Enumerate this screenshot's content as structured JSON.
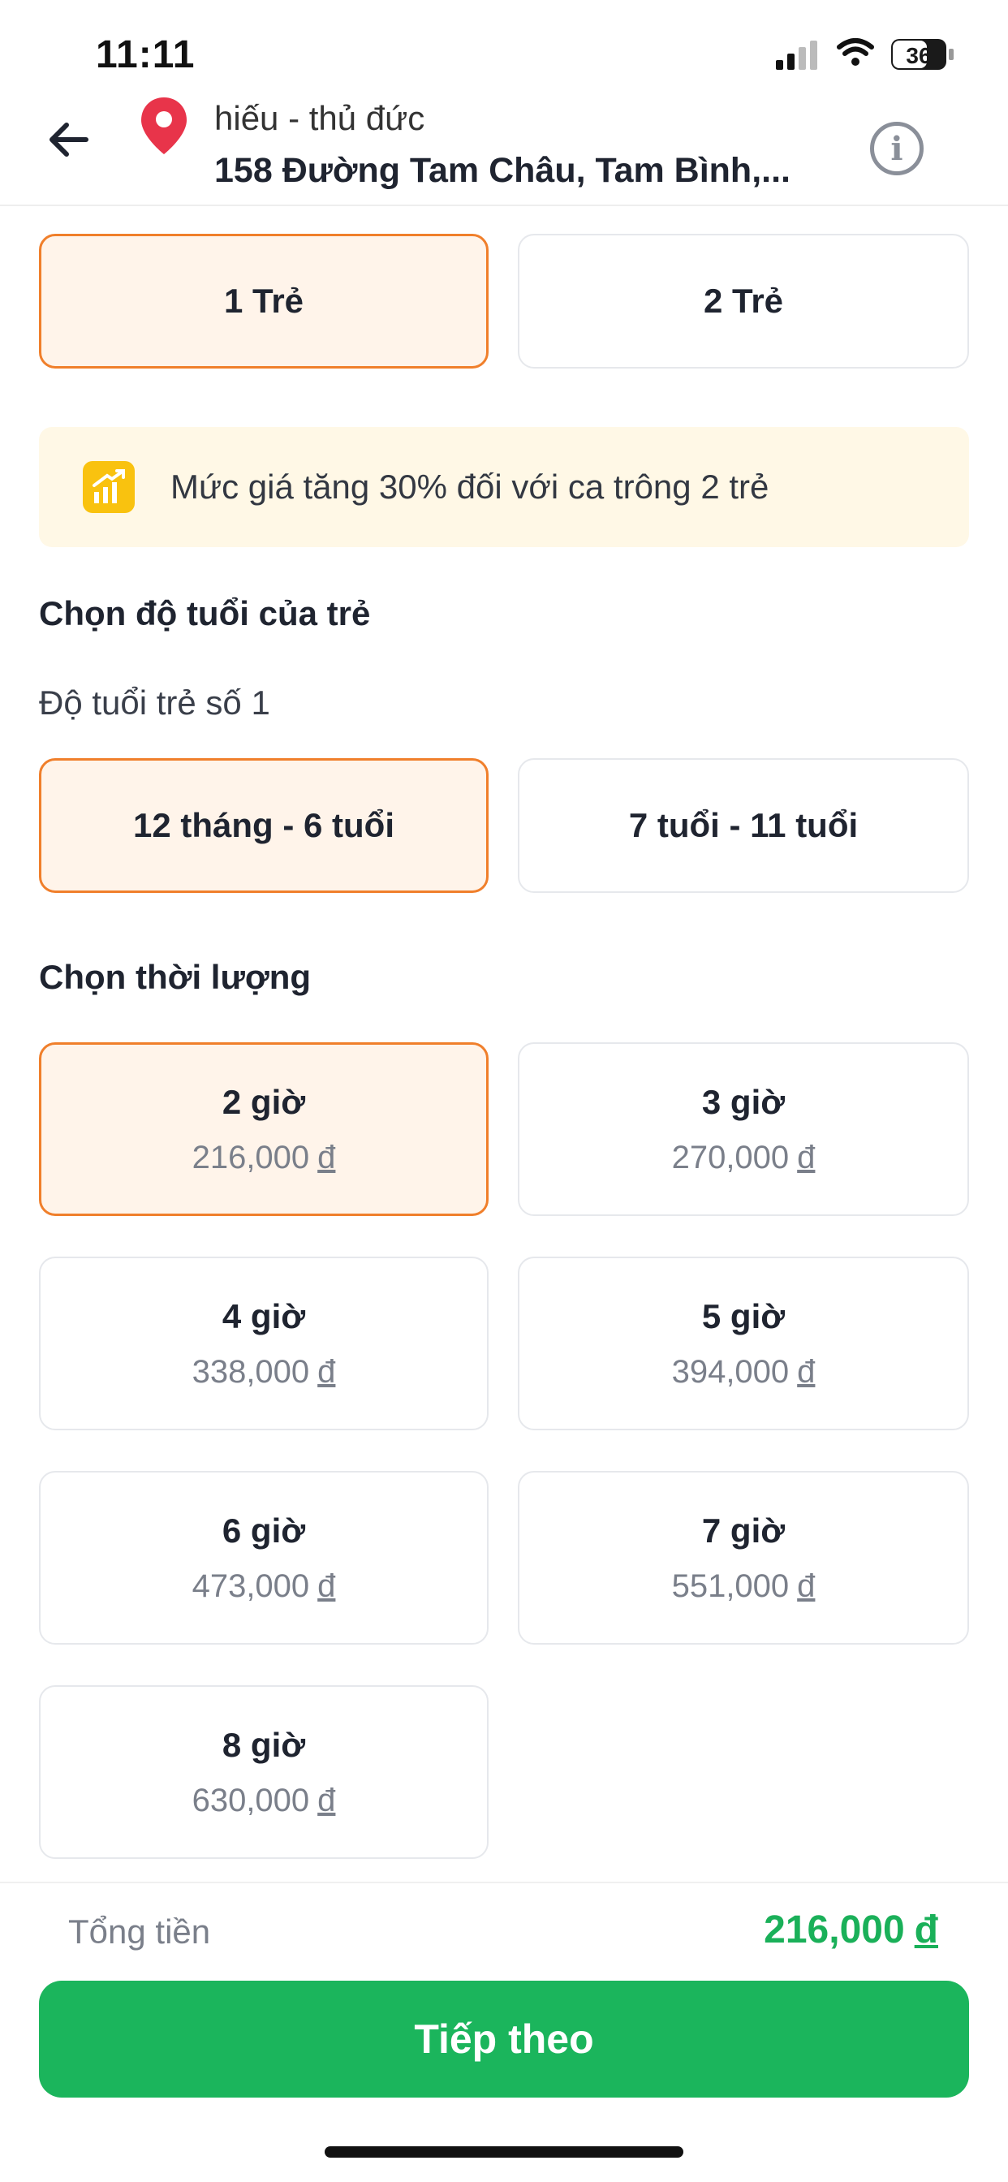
{
  "status_bar": {
    "time": "11:11",
    "battery": "36"
  },
  "header": {
    "contact_name": "hiếu - thủ đức",
    "address": "158 Đường Tam Châu, Tam Bình,..."
  },
  "children_count": {
    "options": [
      "1 Trẻ",
      "2 Trẻ"
    ],
    "selected": "1 Trẻ"
  },
  "notice": {
    "text": "Mức giá tăng 30% đối với ca trông 2 trẻ"
  },
  "age": {
    "title": "Chọn độ tuổi của trẻ",
    "child_label": "Độ tuổi trẻ số 1",
    "options": [
      "12 tháng - 6 tuổi",
      "7 tuổi - 11 tuổi"
    ],
    "selected": "12 tháng - 6 tuổi"
  },
  "duration": {
    "title": "Chọn thời lượng",
    "currency": "đ",
    "options": [
      {
        "label": "2 giờ",
        "price": "216,000"
      },
      {
        "label": "3 giờ",
        "price": "270,000"
      },
      {
        "label": "4 giờ",
        "price": "338,000"
      },
      {
        "label": "5 giờ",
        "price": "394,000"
      },
      {
        "label": "6 giờ",
        "price": "473,000"
      },
      {
        "label": "7 giờ",
        "price": "551,000"
      },
      {
        "label": "8 giờ",
        "price": "630,000"
      }
    ],
    "selected": "2 giờ"
  },
  "footer": {
    "total_label": "Tổng tiền",
    "total_value": "216,000",
    "currency": "đ",
    "next_label": "Tiếp theo"
  },
  "colors": {
    "accent_orange": "#f07f2b",
    "selected_bg": "#fff4ea",
    "green": "#1bb55c",
    "notice_bg": "#fff8e6",
    "pin_red": "#e8344a"
  }
}
